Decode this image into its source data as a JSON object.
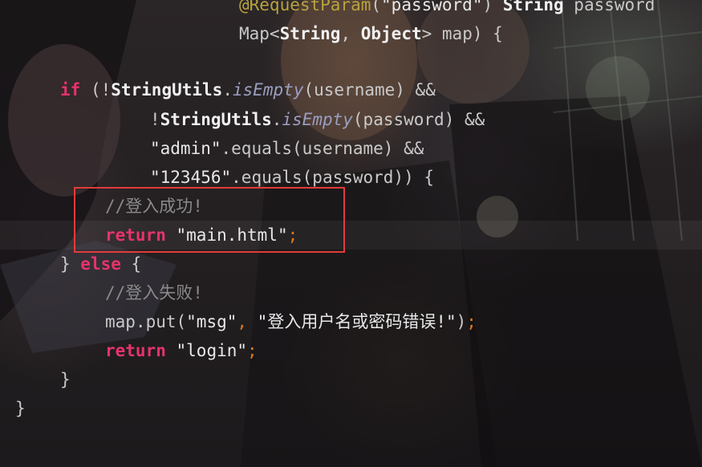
{
  "code": {
    "line1": {
      "ann": "@RequestParam",
      "lp": "(",
      "str": "\"password\"",
      "rp": ")",
      "type": "String",
      "param": "password"
    },
    "line2": {
      "type1": "Map",
      "lt": "<",
      "str_t": "String",
      "comma": ", ",
      "obj_t": "Object",
      "gt": ">",
      "rest": " map) {"
    },
    "line3": {
      "kw": "if",
      "open": " (!",
      "cls": "StringUtils",
      "dot": ".",
      "method": "isEmpty",
      "args": "(username) &&"
    },
    "line4": {
      "neg": "!",
      "cls": "StringUtils",
      "dot": ".",
      "method": "isEmpty",
      "args": "(password) &&"
    },
    "line5": {
      "str": "\"admin\"",
      "rest": ".equals(username) &&"
    },
    "line6": {
      "str": "\"123456\"",
      "rest": ".equals(password)) {"
    },
    "line7": {
      "comment": "//登入成功!"
    },
    "line8": {
      "kw": "return",
      "str": "\"main.html\"",
      "semi": ";"
    },
    "line9": {
      "close": "} ",
      "kw": "else",
      "open": " {"
    },
    "line10": {
      "comment": "//登入失败!"
    },
    "line11": {
      "call": "map.put(",
      "key": "\"msg\"",
      "comma": ", ",
      "val": "\"登入用户名或密码错误!\"",
      "close": ")",
      "semi": ";"
    },
    "line12": {
      "kw": "return",
      "str": "\"login\"",
      "semi": ";"
    },
    "line13": {
      "close": "}"
    },
    "line14": {
      "close": "}"
    }
  },
  "colors": {
    "keyword": "#e6336b",
    "annotation": "#b9a23f",
    "comment": "#8a8a8a",
    "semicolon": "#d87a1e",
    "method_italic": "#9a9ec0",
    "highlight_border": "#e23b3b"
  }
}
